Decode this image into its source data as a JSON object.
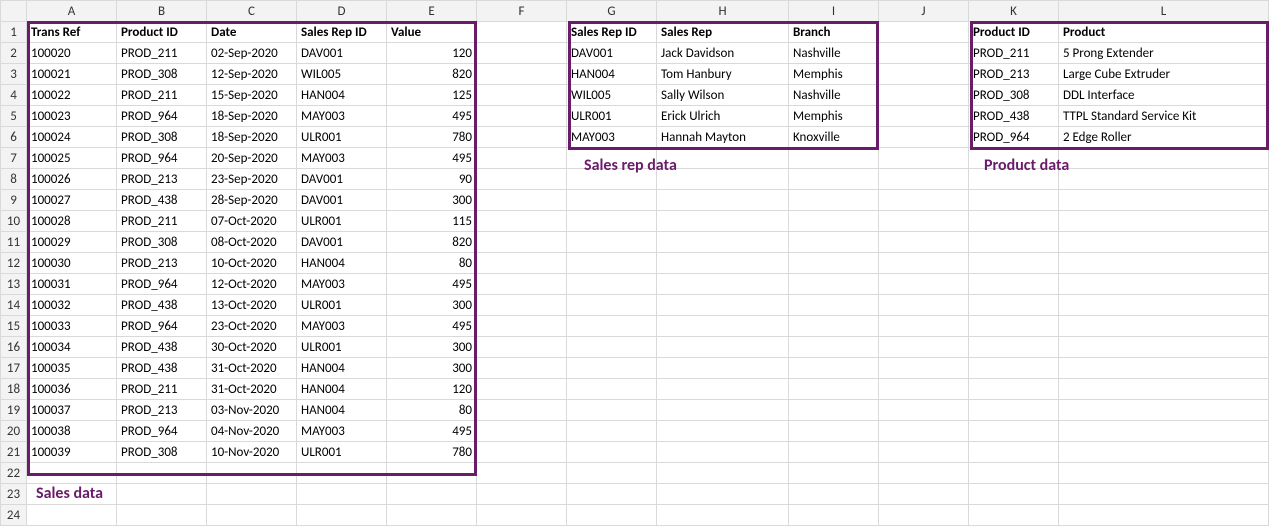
{
  "columns": [
    "A",
    "B",
    "C",
    "D",
    "E",
    "F",
    "G",
    "H",
    "I",
    "J",
    "K",
    "L"
  ],
  "row_count": 24,
  "sales_headers": [
    "Trans Ref",
    "Product ID",
    "Date",
    "Sales Rep ID",
    "Value"
  ],
  "sales_rows": [
    [
      "100020",
      "PROD_211",
      "02-Sep-2020",
      "DAV001",
      "120"
    ],
    [
      "100021",
      "PROD_308",
      "12-Sep-2020",
      "WIL005",
      "820"
    ],
    [
      "100022",
      "PROD_211",
      "15-Sep-2020",
      "HAN004",
      "125"
    ],
    [
      "100023",
      "PROD_964",
      "18-Sep-2020",
      "MAY003",
      "495"
    ],
    [
      "100024",
      "PROD_308",
      "18-Sep-2020",
      "ULR001",
      "780"
    ],
    [
      "100025",
      "PROD_964",
      "20-Sep-2020",
      "MAY003",
      "495"
    ],
    [
      "100026",
      "PROD_213",
      "23-Sep-2020",
      "DAV001",
      "90"
    ],
    [
      "100027",
      "PROD_438",
      "28-Sep-2020",
      "DAV001",
      "300"
    ],
    [
      "100028",
      "PROD_211",
      "07-Oct-2020",
      "ULR001",
      "115"
    ],
    [
      "100029",
      "PROD_308",
      "08-Oct-2020",
      "DAV001",
      "820"
    ],
    [
      "100030",
      "PROD_213",
      "10-Oct-2020",
      "HAN004",
      "80"
    ],
    [
      "100031",
      "PROD_964",
      "12-Oct-2020",
      "MAY003",
      "495"
    ],
    [
      "100032",
      "PROD_438",
      "13-Oct-2020",
      "ULR001",
      "300"
    ],
    [
      "100033",
      "PROD_964",
      "23-Oct-2020",
      "MAY003",
      "495"
    ],
    [
      "100034",
      "PROD_438",
      "30-Oct-2020",
      "ULR001",
      "300"
    ],
    [
      "100035",
      "PROD_438",
      "31-Oct-2020",
      "HAN004",
      "300"
    ],
    [
      "100036",
      "PROD_211",
      "31-Oct-2020",
      "HAN004",
      "120"
    ],
    [
      "100037",
      "PROD_213",
      "03-Nov-2020",
      "HAN004",
      "80"
    ],
    [
      "100038",
      "PROD_964",
      "04-Nov-2020",
      "MAY003",
      "495"
    ],
    [
      "100039",
      "PROD_308",
      "10-Nov-2020",
      "ULR001",
      "780"
    ]
  ],
  "rep_headers": [
    "Sales Rep ID",
    "Sales Rep",
    "Branch"
  ],
  "rep_rows": [
    [
      "DAV001",
      "Jack Davidson",
      "Nashville"
    ],
    [
      "HAN004",
      "Tom Hanbury",
      "Memphis"
    ],
    [
      "WIL005",
      "Sally Wilson",
      "Nashville"
    ],
    [
      "ULR001",
      "Erick Ulrich",
      "Memphis"
    ],
    [
      "MAY003",
      "Hannah Mayton",
      "Knoxville"
    ]
  ],
  "prod_headers": [
    "Product ID",
    "Product"
  ],
  "prod_rows": [
    [
      "PROD_211",
      "5 Prong Extender"
    ],
    [
      "PROD_213",
      "Large Cube Extruder"
    ],
    [
      "PROD_308",
      "DDL Interface"
    ],
    [
      "PROD_438",
      "TTPL Standard Service Kit"
    ],
    [
      "PROD_964",
      "2 Edge Roller"
    ]
  ],
  "captions": {
    "sales": "Sales data",
    "reps": "Sales rep data",
    "products": "Product data"
  }
}
